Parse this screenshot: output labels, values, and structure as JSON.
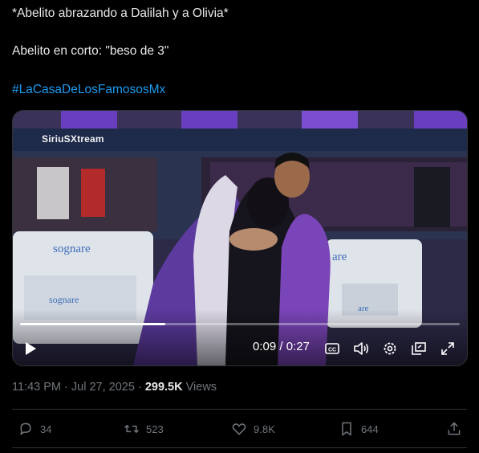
{
  "post": {
    "lines": [
      "*Abelito abrazando a Dalilah y a Olivia*",
      "Abelito en corto: \"beso de 3\"",
      "#LaCasaDeLosFamososMx"
    ]
  },
  "video": {
    "watermark": "SiriuSXtream",
    "sign_text_1": "sognare",
    "sign_text_2": "sognare",
    "sign_text_3": "are",
    "sign_text_4": "are",
    "current_time": "0:09",
    "duration": "0:27",
    "time_display": "0:09 / 0:27",
    "progress_fraction": 0.33
  },
  "meta": {
    "time": "11:43 PM",
    "separator": "·",
    "date": "Jul 27, 2025",
    "views_count": "299.5K",
    "views_label": "Views"
  },
  "actions": {
    "replies": "34",
    "reposts": "523",
    "likes": "9.8K",
    "bookmarks": "644"
  },
  "colors": {
    "link": "#1d9bf0",
    "muted": "#71767b",
    "text": "#e7e9ea"
  }
}
